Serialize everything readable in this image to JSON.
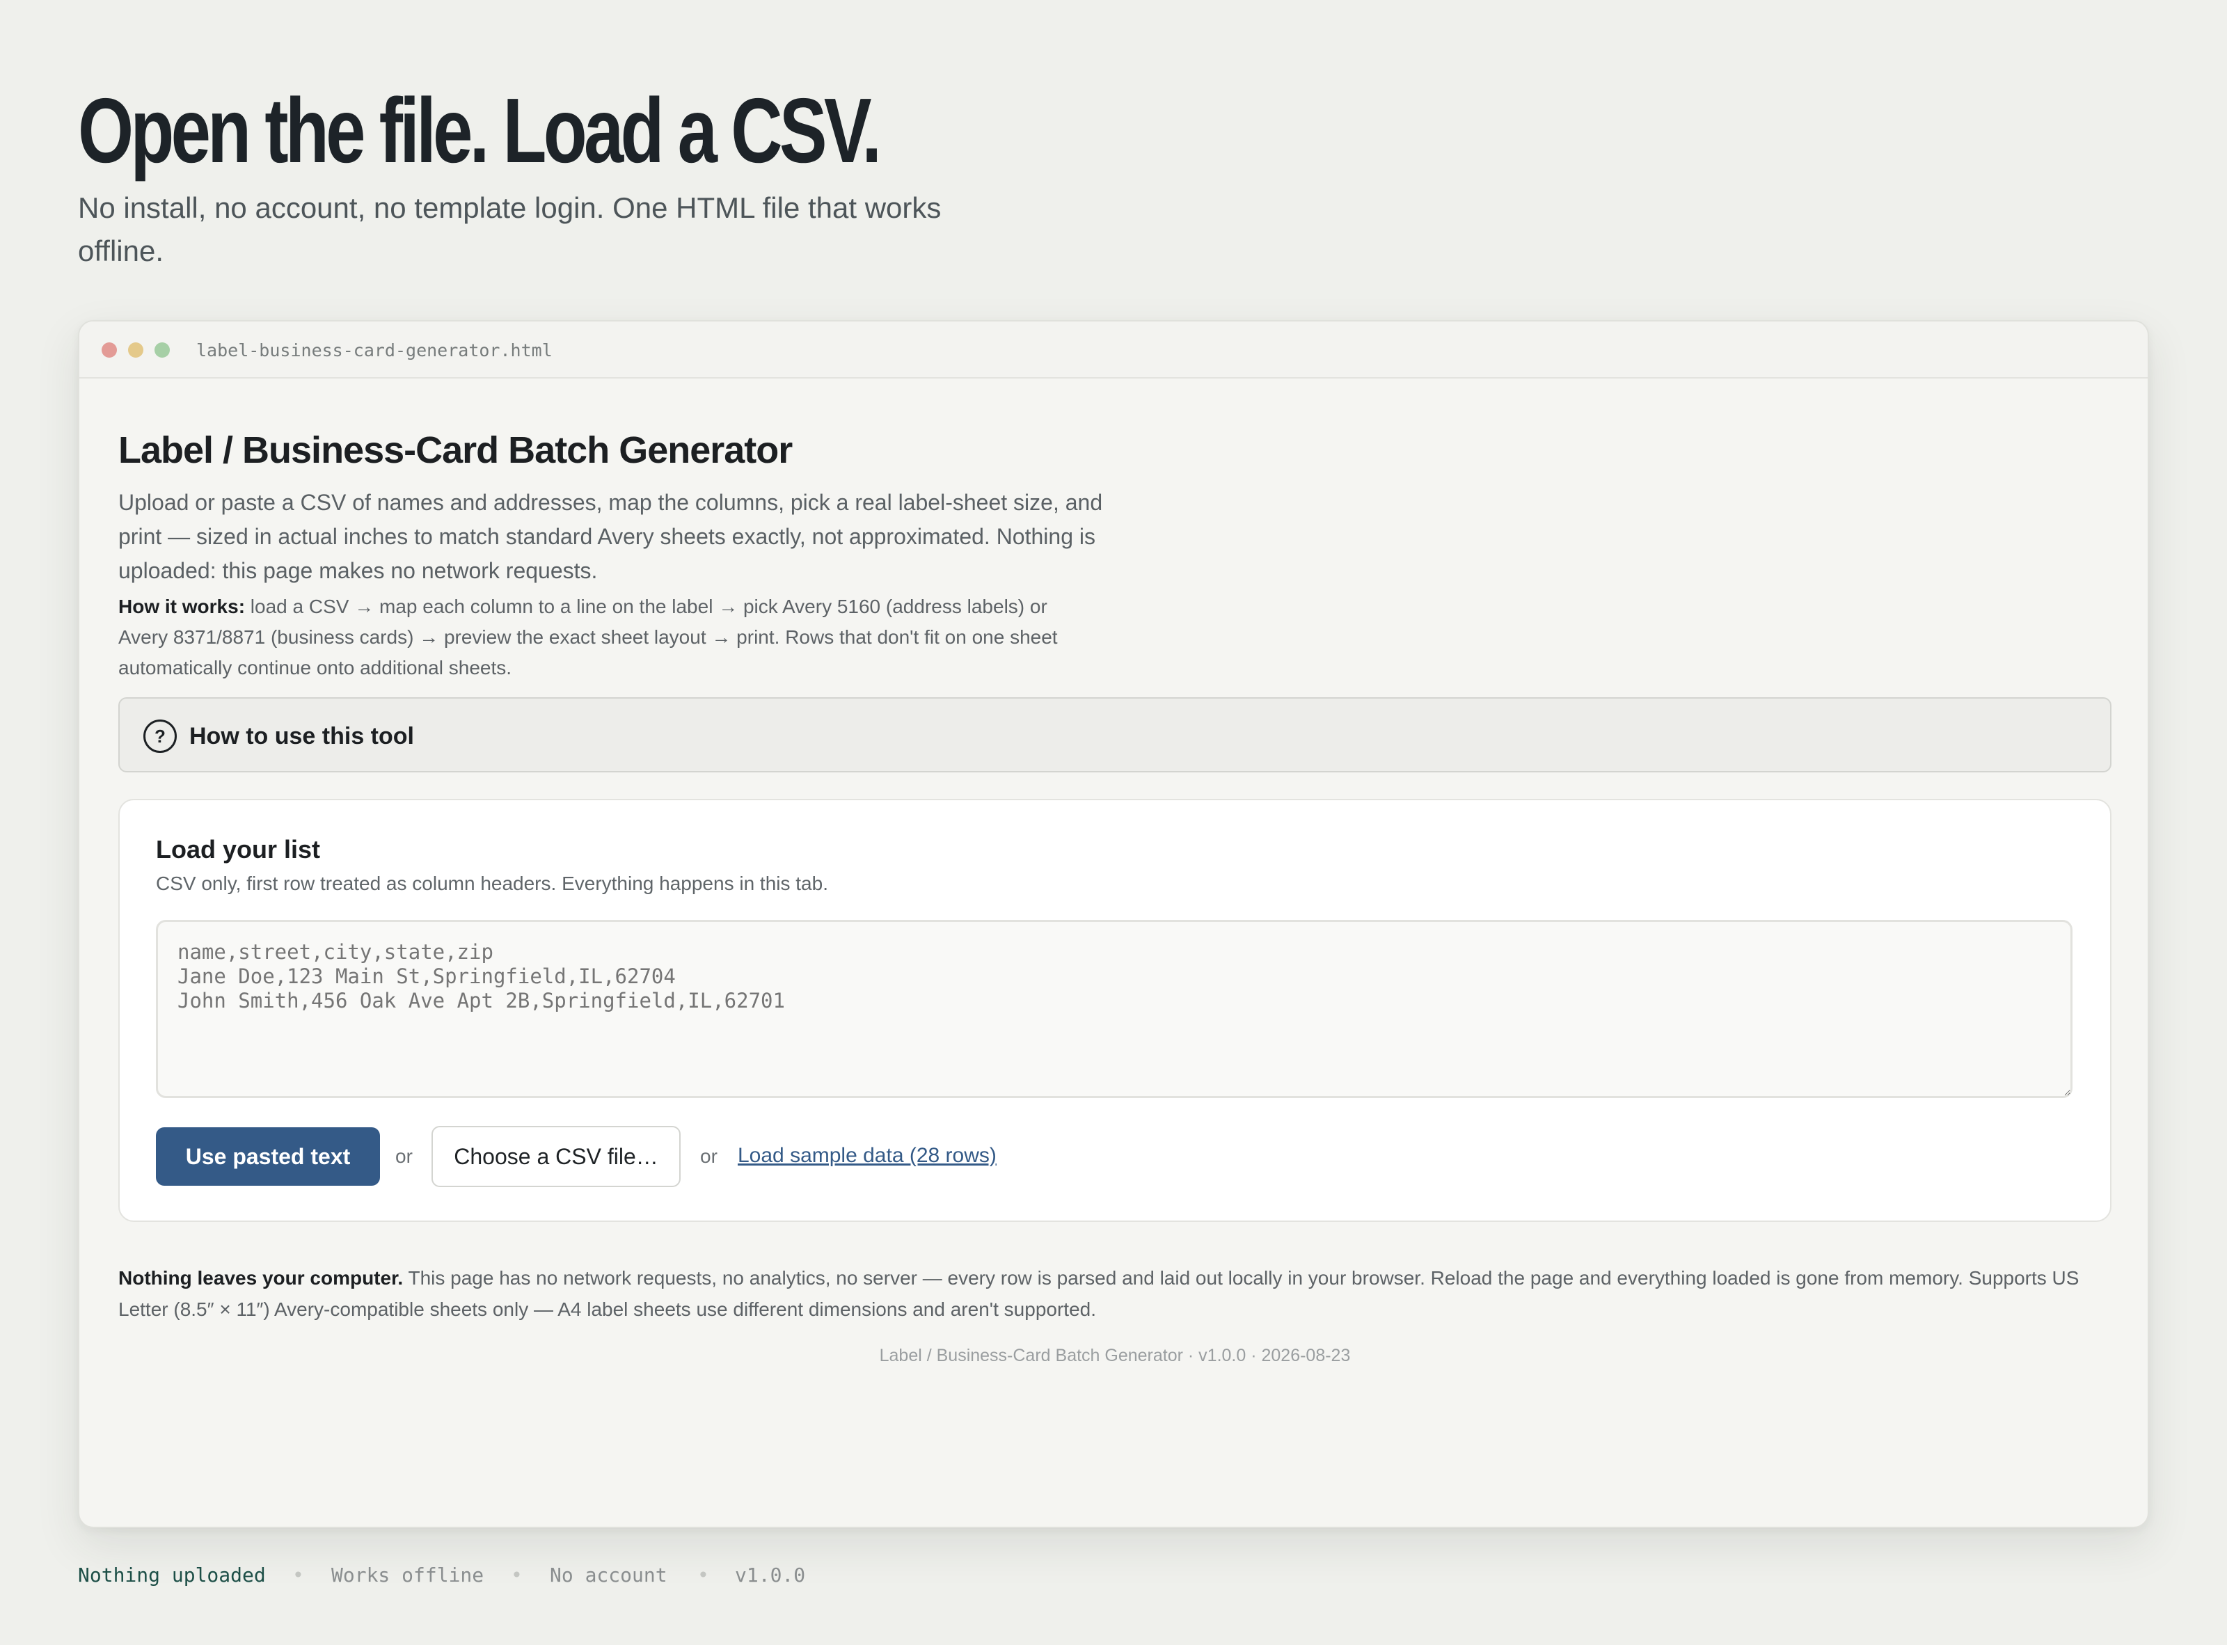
{
  "hero": {
    "title": "Open the file. Load a CSV.",
    "subtitle": "No install, no account, no template login. One HTML file that works offline."
  },
  "window": {
    "filename": "label-business-card-generator.html"
  },
  "app": {
    "title": "Label / Business-Card Batch Generator",
    "description": "Upload or paste a CSV of names and addresses, map the columns, pick a real label-sheet size, and print — sized in actual inches to match standard Avery sheets exactly, not approximated. Nothing is uploaded: this page makes no network requests.",
    "how_label": "How it works:",
    "how_text": " load a CSV → map each column to a line on the label → pick Avery 5160 (address labels) or Avery 8371/8871 (business cards) → preview the exact sheet layout → print. Rows that don't fit on one sheet automatically continue onto additional sheets."
  },
  "howto": {
    "icon": "question-circle-icon",
    "label": "How to use this tool"
  },
  "load": {
    "title": "Load your list",
    "subtitle": "CSV only, first row treated as column headers. Everything happens in this tab.",
    "placeholder": "name,street,city,state,zip\nJane Doe,123 Main St,Springfield,IL,62704\nJohn Smith,456 Oak Ave Apt 2B,Springfield,IL,62701",
    "value": "",
    "use_pasted_label": "Use pasted text",
    "or_1": "or",
    "choose_file_label": "Choose a CSV file…",
    "or_2": "or",
    "sample_link_label": "Load sample data (28 rows)"
  },
  "privacy": {
    "bold": "Nothing leaves your computer.",
    "text": " This page has no network requests, no analytics, no server — every row is parsed and laid out locally in your browser. Reload the page and everything loaded is gone from memory. Supports US Letter (8.5″ × 11″) Avery-compatible sheets only — A4 label sheets use different dimensions and aren't supported."
  },
  "version_line": "Label / Business-Card Batch Generator · v1.0.0 · 2026-08-23",
  "footer": {
    "item1": "Nothing uploaded",
    "separator": "•",
    "item2": "Works offline",
    "item3": "No account",
    "item4": "v1.0.0"
  },
  "colors": {
    "background": "#eff0ec",
    "primary_button": "#345a87",
    "link": "#345a87",
    "footer_accent": "#1d4f47"
  }
}
